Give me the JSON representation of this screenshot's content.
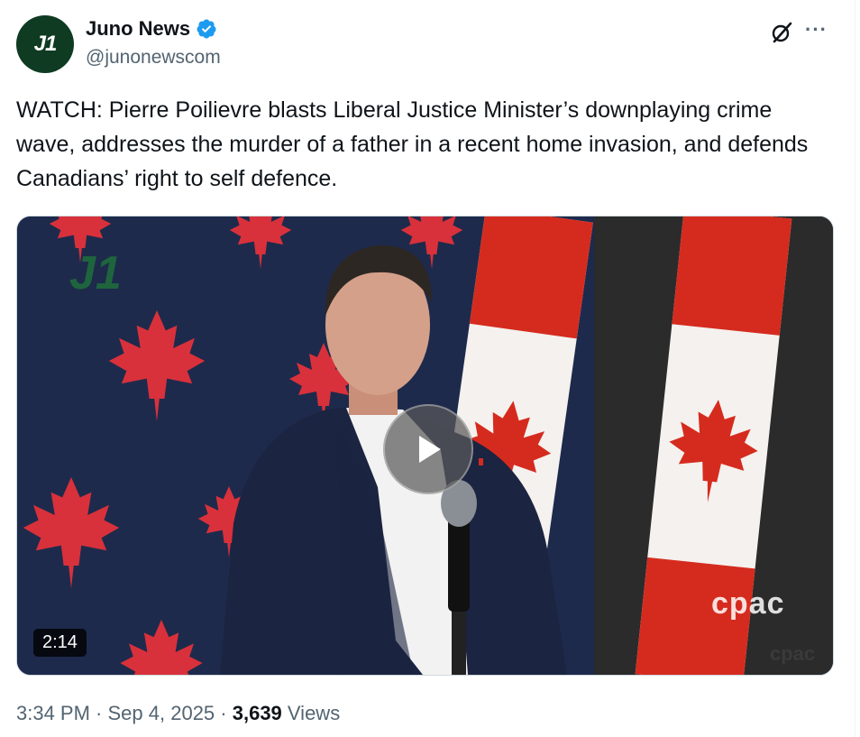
{
  "author": {
    "avatar_text": "J1",
    "display_name": "Juno News",
    "handle": "@junonewscom",
    "verified_color": "#1d9bf0"
  },
  "tweet": {
    "text": "WATCH: Pierre Poilievre blasts Liberal Justice Minister’s downplaying crime wave, addresses the murder of a father in a recent home invasion, and defends Canadians’ right to self defence."
  },
  "media": {
    "duration": "2:14",
    "watermark_main": "cpac",
    "watermark_small": "cpac",
    "logo_text": "J1"
  },
  "meta": {
    "time": "3:34 PM",
    "separator": " · ",
    "date": "Sep 4, 2025",
    "views_count": "3,639",
    "views_label": " Views"
  },
  "icons": {
    "grok": "grok-icon",
    "more": "more-icon",
    "play": "play-icon",
    "verified": "verified-badge-icon"
  }
}
